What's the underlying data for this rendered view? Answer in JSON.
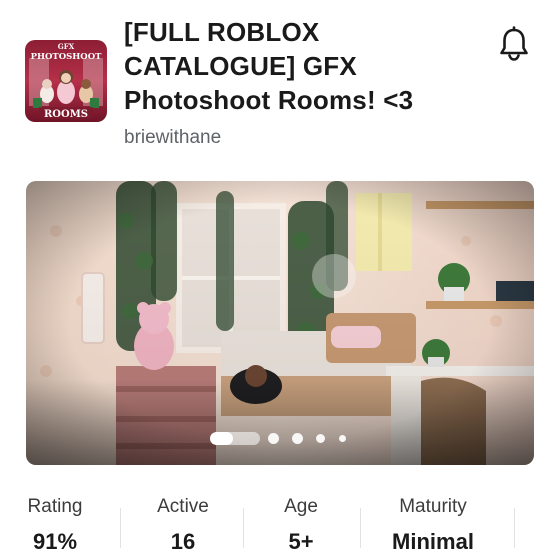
{
  "game": {
    "title": "[FULL ROBLOX CATALOGUE] GFX Photoshoot Rooms! <3",
    "creator": "briewithane",
    "thumbnail_lines": [
      "GFX",
      "PHOTOSHOOT",
      "ROOMS"
    ]
  },
  "header": {
    "notify_icon": "bell-icon"
  },
  "carousel": {
    "slide_count": 5,
    "active_index": 0,
    "active_progress": 0.45
  },
  "stats": [
    {
      "label": "Rating",
      "value": "91%"
    },
    {
      "label": "Active",
      "value": "16"
    },
    {
      "label": "Age",
      "value": "5+"
    },
    {
      "label": "Maturity",
      "value": "Minimal"
    }
  ],
  "colors": {
    "text_primary": "#1a1a1a",
    "text_secondary": "#5f6368",
    "background": "#ffffff"
  }
}
